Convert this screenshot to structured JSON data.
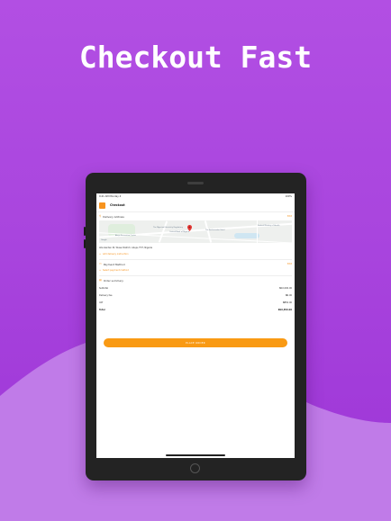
{
  "headline": "Checkout Fast",
  "colors": {
    "accent": "#f7931e",
    "background": "#a945de",
    "wave": "#c07be8"
  },
  "status_bar": {
    "time": "9:41 AM",
    "carrier": "Monday 4",
    "battery": "100%"
  },
  "header": {
    "title": "Checkout"
  },
  "delivery": {
    "label": "Delivery Address",
    "edit": "Edit",
    "map_labels": [
      "Abuja Recreation Center",
      "Central Bank of Nigeria",
      "The Nigerian Electricity Regulatory",
      "Federal Ministry of Health",
      "The Ambassador Hotel",
      "Google"
    ],
    "address": "Alla Garden St, Wuse District, Abuja, FCT, Nigeria",
    "link": "Add delivery instruction"
  },
  "payment": {
    "label": "Payment Method",
    "edit": "Edit",
    "link": "Select payment method"
  },
  "summary": {
    "label": "Order summary",
    "rows": [
      {
        "label": "Subtotal",
        "value": "₦10,000.00"
      },
      {
        "label": "Delivery fee",
        "value": "₦0.00"
      },
      {
        "label": "VAT",
        "value": "₦850.00"
      },
      {
        "label": "Total",
        "value": "₦10,850.00"
      }
    ]
  },
  "place_order": "PLACE ORDER"
}
